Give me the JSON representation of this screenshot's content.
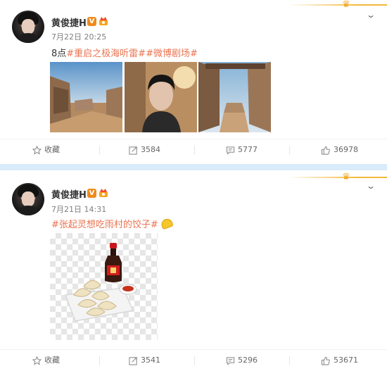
{
  "colors": {
    "accent": "#eb7350",
    "badge": "#f08a1b",
    "separator": "#d9ecfb"
  },
  "posts": [
    {
      "author": "黄俊捷H",
      "verified_badge": "V",
      "time": "7月22日 20:25",
      "text_prefix": "8点",
      "tags": [
        "#重启之极海听雷#",
        "#微博剧场#"
      ],
      "images": [
        "desert-town-photo",
        "selfie-photo",
        "desert-town-alley-photo"
      ],
      "actions": {
        "favorite_label": "收藏",
        "repost_count": "3584",
        "comment_count": "5777",
        "like_count": "36978"
      }
    },
    {
      "author": "黄俊捷H",
      "verified_badge": "V",
      "time": "7月21日 14:31",
      "tags": [
        "#张起灵想吃雨村的饺子#"
      ],
      "emoji": "dumpling-emoji",
      "images": [
        "dumplings-soy-sauce-image"
      ],
      "actions": {
        "favorite_label": "收藏",
        "repost_count": "3541",
        "comment_count": "5296",
        "like_count": "53671"
      }
    }
  ]
}
